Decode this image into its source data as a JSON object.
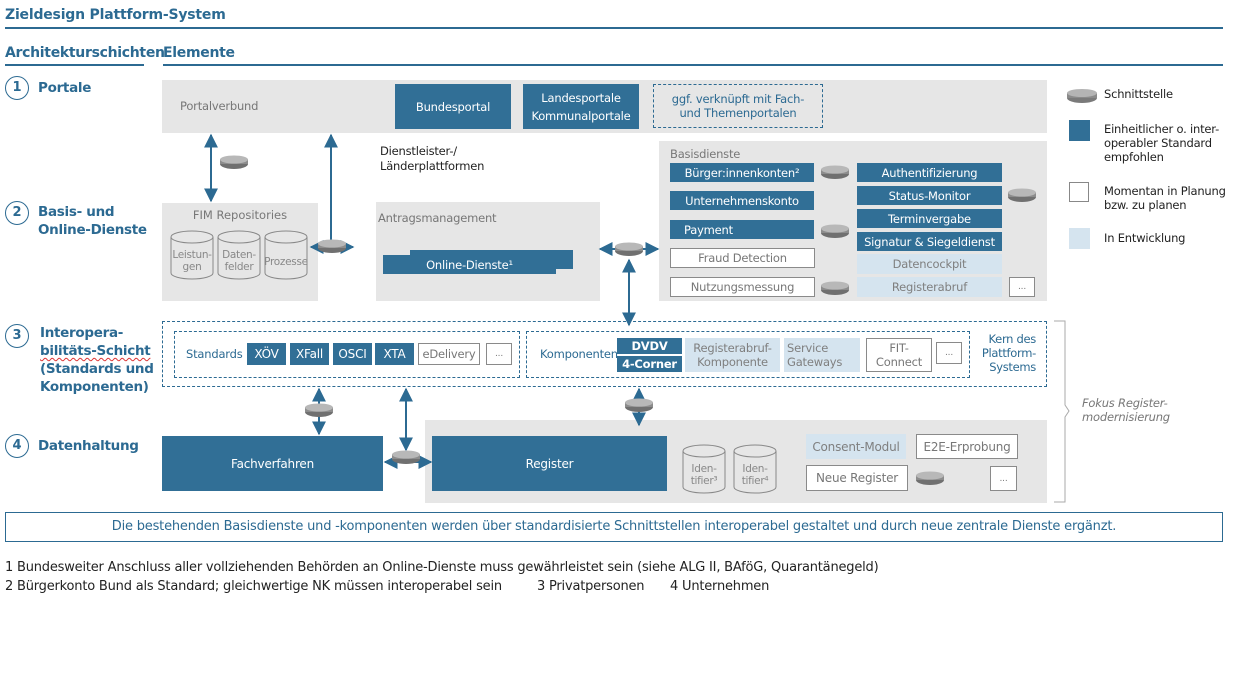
{
  "title": "Zieldesign Plattform-System",
  "headers": {
    "layers": "Architekturschichten",
    "elements": "Elemente"
  },
  "layers": [
    {
      "num": "1",
      "label": "Portale"
    },
    {
      "num": "2",
      "label_line1": "Basis- und",
      "label_line2": "Online-Dienste"
    },
    {
      "num": "3",
      "label_line1": "Interopera-",
      "label_line2": "bilitäts-Schicht",
      "label_line3": "(Standards und",
      "label_line4": "Komponenten)"
    },
    {
      "num": "4",
      "label": "Datenhaltung"
    }
  ],
  "portale": {
    "group_label": "Portalverbund",
    "bundesportal": "Bundesportal",
    "landes_line1": "Landesportale",
    "landes_line2": "Kommunalportale",
    "fach_line1": "ggf. verknüpft mit Fach-",
    "fach_line2": "und Themenportalen"
  },
  "dienstleister": {
    "line1": "Dienstleister-/",
    "line2": "Länderplattformen"
  },
  "fim": {
    "label": "FIM Repositories",
    "repos": [
      {
        "line1": "Leistun-",
        "line2": "gen"
      },
      {
        "line1": "Daten-",
        "line2": "felder"
      },
      {
        "line1": "Prozesse",
        "line2": ""
      }
    ]
  },
  "antrag": {
    "label": "Antragsmanagement",
    "online_dienste": "Online-Dienste¹"
  },
  "basisdienste": {
    "label": "Basisdienste",
    "left": [
      {
        "label": "Bürger:innenkonten²",
        "status": "standard"
      },
      {
        "label": "Unternehmenskonto",
        "status": "standard"
      },
      {
        "label": "Payment",
        "status": "standard"
      },
      {
        "label": "Fraud Detection",
        "status": "planning"
      },
      {
        "label": "Nutzungsmessung",
        "status": "planning"
      }
    ],
    "right": [
      {
        "label": "Authentifizierung",
        "status": "standard"
      },
      {
        "label": "Status-Monitor",
        "status": "standard"
      },
      {
        "label": "Terminvergabe",
        "status": "standard"
      },
      {
        "label": "Signatur & Siegeldienst",
        "status": "standard"
      },
      {
        "label": "Datencockpit",
        "status": "development"
      },
      {
        "label": "Registerabruf",
        "status": "development"
      }
    ],
    "more": "..."
  },
  "interop": {
    "standards_label": "Standards",
    "standards": [
      {
        "label": "XÖV",
        "status": "standard"
      },
      {
        "label": "XFall",
        "status": "standard"
      },
      {
        "label": "OSCI",
        "status": "standard"
      },
      {
        "label": "XTA",
        "status": "standard"
      },
      {
        "label": "eDelivery",
        "status": "planning"
      },
      {
        "label": "...",
        "status": "planning"
      }
    ],
    "komponenten_label": "Komponenten",
    "dvdv": "DVDV",
    "corner": "4-Corner",
    "registerabruf_line1": "Registerabruf-",
    "registerabruf_line2": "Komponente",
    "gateways_line1": "Service",
    "gateways_line2": "Gateways",
    "fit_line1": "FIT-",
    "fit_line2": "Connect",
    "more": "...",
    "kern_line1": "Kern des",
    "kern_line2": "Plattform-",
    "kern_line3": "Systems"
  },
  "datenhaltung": {
    "fachverfahren": "Fachverfahren",
    "register": "Register",
    "identifier": [
      {
        "line1": "Iden-",
        "line2": "tifier³"
      },
      {
        "line1": "Iden-",
        "line2": "tifier⁴"
      }
    ],
    "consent": "Consent-Modul",
    "e2e": "E2E-Erprobung",
    "neue_register": "Neue Register",
    "more": "..."
  },
  "fokus": {
    "line1": "Fokus Register-",
    "line2": "modernisierung"
  },
  "legend": [
    {
      "icon": "router-icon",
      "label_line1": "Schnittstelle"
    },
    {
      "icon": "dark-square",
      "label_line1": "Einheitlicher o. inter-",
      "label_line2": "operabler Standard",
      "label_line3": "empfohlen"
    },
    {
      "icon": "outline-square",
      "label_line1": "Momentan in Planung",
      "label_line2": "bzw. zu planen"
    },
    {
      "icon": "light-square",
      "label_line1": "In Entwicklung"
    }
  ],
  "info": "Die bestehenden Basisdienste und -komponenten werden über standardisierte Schnittstellen interoperabel gestaltet und durch neue zentrale Dienste ergänzt.",
  "footnotes": {
    "f1": "1  Bundesweiter Anschluss aller vollziehenden Behörden an Online-Dienste muss gewährleistet sein (siehe ALG II, BAföG, Quarantänegeld)",
    "f2": "2  Bürgerkonto Bund als Standard; gleichwertige NK müssen interoperabel sein",
    "f3": "3  Privatpersonen",
    "f4": "4  Unternehmen"
  },
  "colors": {
    "standard": "#316f96",
    "development": "#d5e4ef",
    "planning_border": "#8a8a8a",
    "group_bg": "#e6e6e6",
    "accent": "#2c6a92"
  }
}
